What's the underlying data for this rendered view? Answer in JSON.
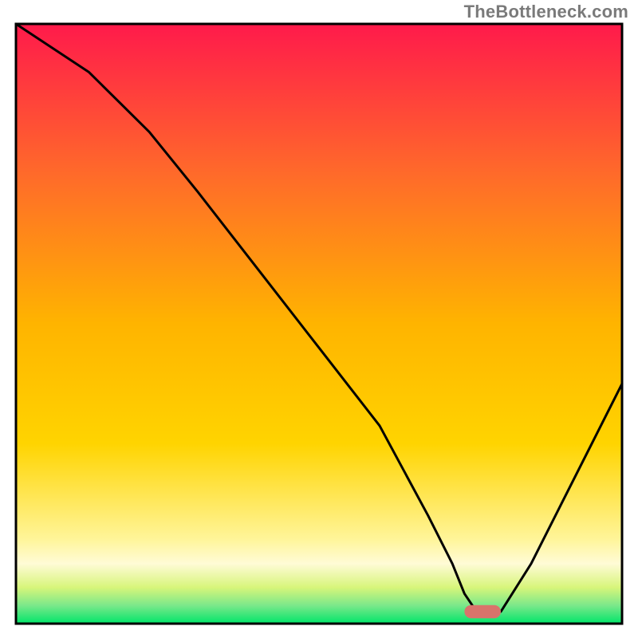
{
  "watermark": "TheBottleneck.com",
  "chart_data": {
    "type": "line",
    "title": "",
    "xlabel": "",
    "ylabel": "",
    "xlim": [
      0,
      100
    ],
    "ylim": [
      0,
      100
    ],
    "background_gradient": {
      "top_color": "#ff1a4b",
      "mid_color": "#ffd400",
      "bottom_color": "#00e56a"
    },
    "bands": {
      "cream_band_y": [
        7,
        13
      ],
      "green_edge_y": [
        0,
        3
      ]
    },
    "curve": {
      "x": [
        0,
        12,
        22,
        30,
        40,
        50,
        60,
        68,
        72,
        74,
        76,
        78,
        80,
        85,
        90,
        95,
        100
      ],
      "y": [
        100,
        92,
        82,
        72,
        59,
        46,
        33,
        18,
        10,
        5,
        2,
        2,
        2,
        10,
        20,
        30,
        40
      ]
    },
    "minimum_marker": {
      "x": 77,
      "y": 2,
      "width": 6,
      "height": 2.2,
      "color": "#d9736b"
    },
    "frame_color": "#000000",
    "curve_color": "#000000"
  }
}
